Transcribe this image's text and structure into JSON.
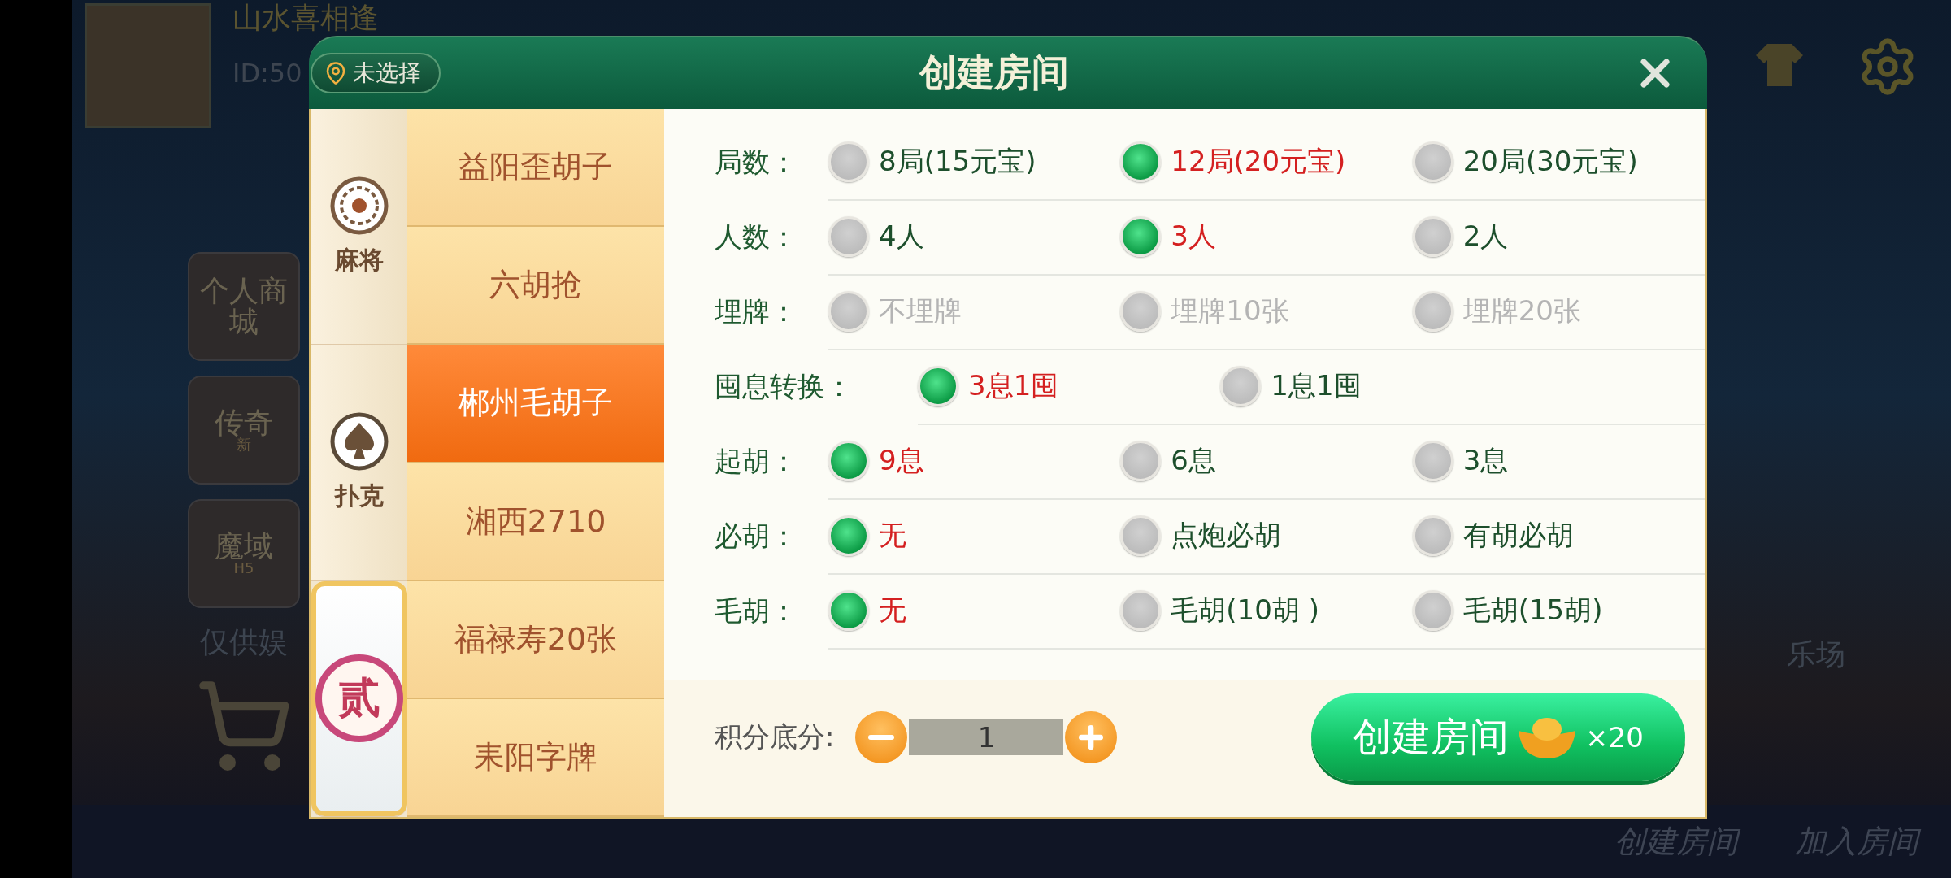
{
  "lobby": {
    "player_name": "山水喜相逢",
    "player_id": "ID:50",
    "side_buttons": [
      "个人商城",
      "传奇",
      "魔域"
    ],
    "side_tags": [
      "新",
      "H5"
    ],
    "note": "仅供娱",
    "hall_label": "乐场",
    "bottom_buttons": [
      "创建房间",
      "加入房间"
    ]
  },
  "dialog": {
    "title": "创建房间",
    "location": "未选择",
    "categories": [
      {
        "label": "麻将",
        "kind": "mahjong",
        "selected": false
      },
      {
        "label": "扑克",
        "kind": "spade",
        "selected": false
      },
      {
        "label": "贰",
        "kind": "badge",
        "selected": true
      }
    ],
    "games": [
      {
        "label": "益阳歪胡子",
        "selected": false
      },
      {
        "label": "六胡抢",
        "selected": false
      },
      {
        "label": "郴州毛胡子",
        "selected": true
      },
      {
        "label": "湘西2710",
        "selected": false
      },
      {
        "label": "福禄寿20张",
        "selected": false
      },
      {
        "label": "耒阳字牌",
        "selected": false
      }
    ],
    "settings": [
      {
        "label": "局数：",
        "options": [
          {
            "label": "8局(15元宝)",
            "selected": false,
            "disabled": false
          },
          {
            "label": "12局(20元宝)",
            "selected": true,
            "disabled": false
          },
          {
            "label": "20局(30元宝)",
            "selected": false,
            "disabled": false
          }
        ]
      },
      {
        "label": "人数：",
        "options": [
          {
            "label": "4人",
            "selected": false,
            "disabled": false
          },
          {
            "label": "3人",
            "selected": true,
            "disabled": false
          },
          {
            "label": "2人",
            "selected": false,
            "disabled": false
          }
        ]
      },
      {
        "label": "埋牌：",
        "options": [
          {
            "label": "不埋牌",
            "selected": false,
            "disabled": true
          },
          {
            "label": "埋牌10张",
            "selected": false,
            "disabled": true
          },
          {
            "label": "埋牌20张",
            "selected": false,
            "disabled": true
          }
        ]
      },
      {
        "label": "囤息转换：",
        "options": [
          {
            "label": "3息1囤",
            "selected": true,
            "disabled": false
          },
          {
            "label": "1息1囤",
            "selected": false,
            "disabled": false
          }
        ]
      },
      {
        "label": "起胡：",
        "options": [
          {
            "label": "9息",
            "selected": true,
            "disabled": false
          },
          {
            "label": "6息",
            "selected": false,
            "disabled": false
          },
          {
            "label": "3息",
            "selected": false,
            "disabled": false
          }
        ]
      },
      {
        "label": "必胡：",
        "options": [
          {
            "label": "无",
            "selected": true,
            "disabled": false
          },
          {
            "label": "点炮必胡",
            "selected": false,
            "disabled": false
          },
          {
            "label": "有胡必胡",
            "selected": false,
            "disabled": false
          }
        ]
      },
      {
        "label": "毛胡：",
        "options": [
          {
            "label": "无",
            "selected": true,
            "disabled": false
          },
          {
            "label": "毛胡(10胡 )",
            "selected": false,
            "disabled": false
          },
          {
            "label": "毛胡(15胡)",
            "selected": false,
            "disabled": false
          }
        ]
      }
    ],
    "score": {
      "label": "积分底分:",
      "value": "1"
    },
    "create_button": {
      "label": "创建房间",
      "cost": "×20"
    }
  }
}
